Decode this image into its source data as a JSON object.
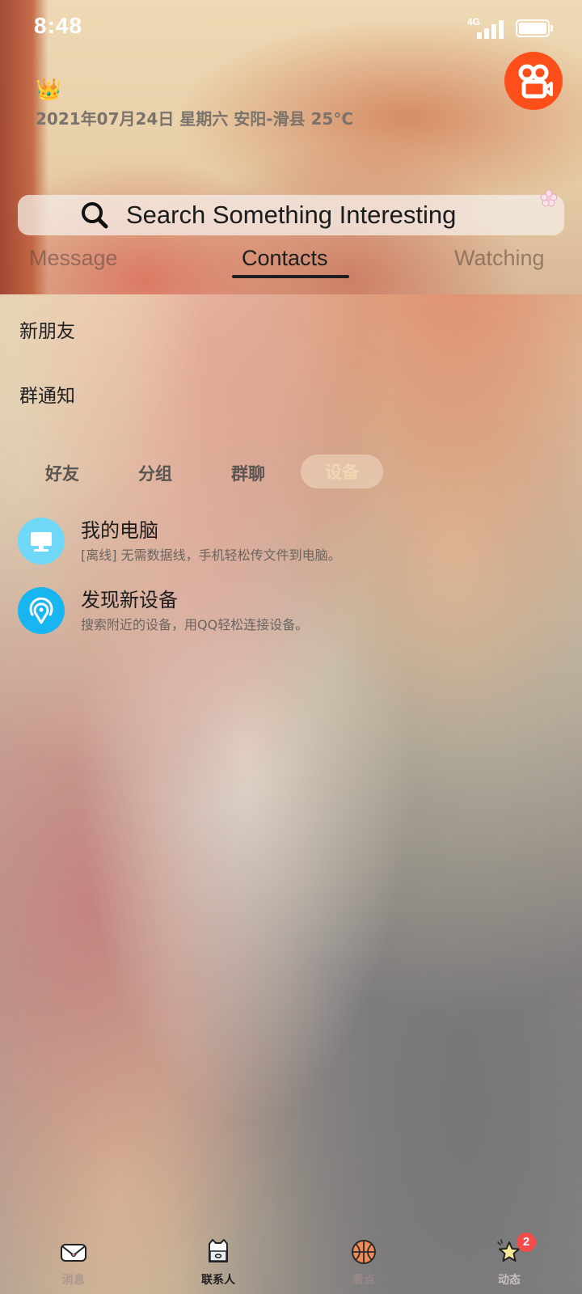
{
  "status_bar": {
    "time": "8:48",
    "network": "4G"
  },
  "header": {
    "date_location": "2021年07月24日 星期六 安阳-滑县 25°C",
    "search_placeholder": "Search Something Interesting",
    "tabs": [
      {
        "label": "Message",
        "active": false
      },
      {
        "label": "Contacts",
        "active": true
      },
      {
        "label": "Watching",
        "active": false
      }
    ]
  },
  "contacts": {
    "new_friends": "新朋友",
    "group_notice": "群通知",
    "segments": [
      {
        "label": "好友",
        "active": false
      },
      {
        "label": "分组",
        "active": false
      },
      {
        "label": "群聊",
        "active": false
      },
      {
        "label": "设备",
        "active": true
      }
    ],
    "devices": [
      {
        "title": "我的电脑",
        "subtitle": "[离线] 无需数据线，手机轻松传文件到电脑。",
        "icon": "computer-icon",
        "color": "#6fd8f9"
      },
      {
        "title": "发现新设备",
        "subtitle": "搜索附近的设备，用QQ轻松连接设备。",
        "icon": "radar-icon",
        "color": "#18b6f0"
      }
    ]
  },
  "bottom_nav": {
    "items": [
      {
        "label": "消息",
        "icon": "message-icon",
        "active": false
      },
      {
        "label": "联系人",
        "icon": "contacts-icon",
        "active": true
      },
      {
        "label": "看点",
        "icon": "basketball-icon",
        "active": false
      },
      {
        "label": "动态",
        "icon": "star-icon",
        "active": false
      }
    ],
    "badge": "2"
  },
  "colors": {
    "accent_kuaishou": "#fe4e1a",
    "device_blue": "#18b6f0",
    "badge_red": "#f24c4c"
  }
}
